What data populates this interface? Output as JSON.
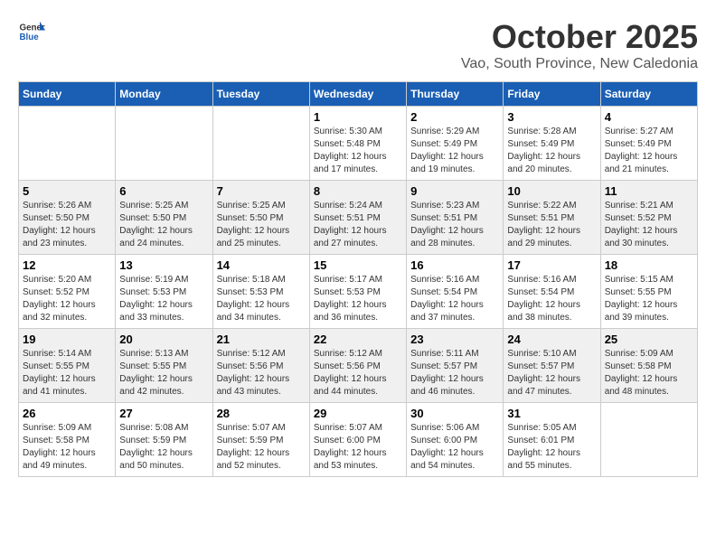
{
  "header": {
    "logo": {
      "general": "General",
      "blue": "Blue"
    },
    "title": "October 2025",
    "location": "Vao, South Province, New Caledonia"
  },
  "days_of_week": [
    "Sunday",
    "Monday",
    "Tuesday",
    "Wednesday",
    "Thursday",
    "Friday",
    "Saturday"
  ],
  "weeks": [
    [
      {
        "day": "",
        "info": ""
      },
      {
        "day": "",
        "info": ""
      },
      {
        "day": "",
        "info": ""
      },
      {
        "day": "1",
        "sunrise": "5:30 AM",
        "sunset": "5:48 PM",
        "daylight": "12 hours and 17 minutes."
      },
      {
        "day": "2",
        "sunrise": "5:29 AM",
        "sunset": "5:49 PM",
        "daylight": "12 hours and 19 minutes."
      },
      {
        "day": "3",
        "sunrise": "5:28 AM",
        "sunset": "5:49 PM",
        "daylight": "12 hours and 20 minutes."
      },
      {
        "day": "4",
        "sunrise": "5:27 AM",
        "sunset": "5:49 PM",
        "daylight": "12 hours and 21 minutes."
      }
    ],
    [
      {
        "day": "5",
        "sunrise": "5:26 AM",
        "sunset": "5:50 PM",
        "daylight": "12 hours and 23 minutes."
      },
      {
        "day": "6",
        "sunrise": "5:25 AM",
        "sunset": "5:50 PM",
        "daylight": "12 hours and 24 minutes."
      },
      {
        "day": "7",
        "sunrise": "5:25 AM",
        "sunset": "5:50 PM",
        "daylight": "12 hours and 25 minutes."
      },
      {
        "day": "8",
        "sunrise": "5:24 AM",
        "sunset": "5:51 PM",
        "daylight": "12 hours and 27 minutes."
      },
      {
        "day": "9",
        "sunrise": "5:23 AM",
        "sunset": "5:51 PM",
        "daylight": "12 hours and 28 minutes."
      },
      {
        "day": "10",
        "sunrise": "5:22 AM",
        "sunset": "5:51 PM",
        "daylight": "12 hours and 29 minutes."
      },
      {
        "day": "11",
        "sunrise": "5:21 AM",
        "sunset": "5:52 PM",
        "daylight": "12 hours and 30 minutes."
      }
    ],
    [
      {
        "day": "12",
        "sunrise": "5:20 AM",
        "sunset": "5:52 PM",
        "daylight": "12 hours and 32 minutes."
      },
      {
        "day": "13",
        "sunrise": "5:19 AM",
        "sunset": "5:53 PM",
        "daylight": "12 hours and 33 minutes."
      },
      {
        "day": "14",
        "sunrise": "5:18 AM",
        "sunset": "5:53 PM",
        "daylight": "12 hours and 34 minutes."
      },
      {
        "day": "15",
        "sunrise": "5:17 AM",
        "sunset": "5:53 PM",
        "daylight": "12 hours and 36 minutes."
      },
      {
        "day": "16",
        "sunrise": "5:16 AM",
        "sunset": "5:54 PM",
        "daylight": "12 hours and 37 minutes."
      },
      {
        "day": "17",
        "sunrise": "5:16 AM",
        "sunset": "5:54 PM",
        "daylight": "12 hours and 38 minutes."
      },
      {
        "day": "18",
        "sunrise": "5:15 AM",
        "sunset": "5:55 PM",
        "daylight": "12 hours and 39 minutes."
      }
    ],
    [
      {
        "day": "19",
        "sunrise": "5:14 AM",
        "sunset": "5:55 PM",
        "daylight": "12 hours and 41 minutes."
      },
      {
        "day": "20",
        "sunrise": "5:13 AM",
        "sunset": "5:55 PM",
        "daylight": "12 hours and 42 minutes."
      },
      {
        "day": "21",
        "sunrise": "5:12 AM",
        "sunset": "5:56 PM",
        "daylight": "12 hours and 43 minutes."
      },
      {
        "day": "22",
        "sunrise": "5:12 AM",
        "sunset": "5:56 PM",
        "daylight": "12 hours and 44 minutes."
      },
      {
        "day": "23",
        "sunrise": "5:11 AM",
        "sunset": "5:57 PM",
        "daylight": "12 hours and 46 minutes."
      },
      {
        "day": "24",
        "sunrise": "5:10 AM",
        "sunset": "5:57 PM",
        "daylight": "12 hours and 47 minutes."
      },
      {
        "day": "25",
        "sunrise": "5:09 AM",
        "sunset": "5:58 PM",
        "daylight": "12 hours and 48 minutes."
      }
    ],
    [
      {
        "day": "26",
        "sunrise": "5:09 AM",
        "sunset": "5:58 PM",
        "daylight": "12 hours and 49 minutes."
      },
      {
        "day": "27",
        "sunrise": "5:08 AM",
        "sunset": "5:59 PM",
        "daylight": "12 hours and 50 minutes."
      },
      {
        "day": "28",
        "sunrise": "5:07 AM",
        "sunset": "5:59 PM",
        "daylight": "12 hours and 52 minutes."
      },
      {
        "day": "29",
        "sunrise": "5:07 AM",
        "sunset": "6:00 PM",
        "daylight": "12 hours and 53 minutes."
      },
      {
        "day": "30",
        "sunrise": "5:06 AM",
        "sunset": "6:00 PM",
        "daylight": "12 hours and 54 minutes."
      },
      {
        "day": "31",
        "sunrise": "5:05 AM",
        "sunset": "6:01 PM",
        "daylight": "12 hours and 55 minutes."
      },
      {
        "day": "",
        "info": ""
      }
    ]
  ],
  "labels": {
    "sunrise": "Sunrise:",
    "sunset": "Sunset:",
    "daylight": "Daylight:"
  }
}
